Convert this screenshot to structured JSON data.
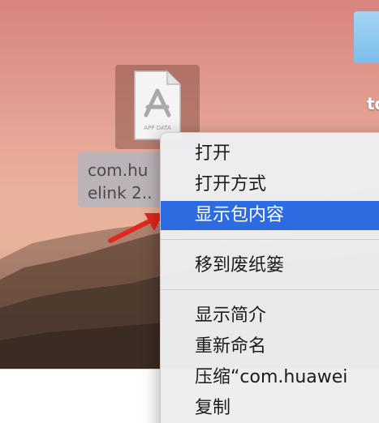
{
  "desktop": {
    "folder_label": "to",
    "file": {
      "icon_badge": "APP DATA",
      "label_line1": "com.hu",
      "label_line2": "elink 2.."
    }
  },
  "context_menu": {
    "items": [
      {
        "label": "打开",
        "highlighted": false
      },
      {
        "label": "打开方式",
        "highlighted": false
      },
      {
        "label": "显示包内容",
        "highlighted": true
      },
      {
        "label": "移到废纸篓",
        "highlighted": false
      },
      {
        "label": "显示简介",
        "highlighted": false
      },
      {
        "label": "重新命名",
        "highlighted": false
      },
      {
        "label": "压缩“com.huawei",
        "highlighted": false
      },
      {
        "label": "复制",
        "highlighted": false
      }
    ]
  },
  "colors": {
    "highlight": "#2d6ce0",
    "arrow": "#e0281e"
  },
  "icons": [
    "app-data-file-icon",
    "folder-icon",
    "red-arrow-annotation"
  ]
}
